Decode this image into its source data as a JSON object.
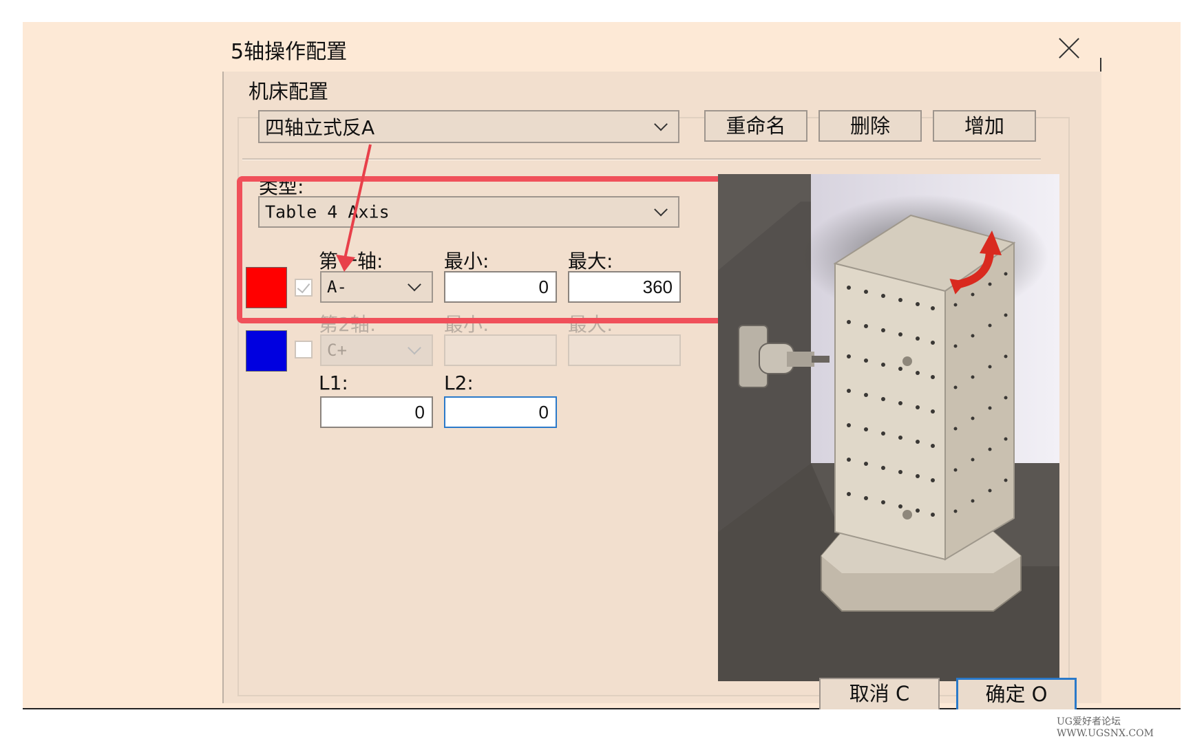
{
  "dialog": {
    "title": "5轴操作配置",
    "close_icon": "close-icon"
  },
  "machine_config": {
    "group_label": "机床配置",
    "selected": "四轴立式反A",
    "rename_label": "重命名",
    "delete_label": "删除",
    "add_label": "增加"
  },
  "type": {
    "label": "类型:",
    "selected": "Table 4 Axis"
  },
  "axis1": {
    "label": "第一轴:",
    "min_label": "最小:",
    "max_label": "最大:",
    "axis": "A-",
    "min": "0",
    "max": "360",
    "color": "#ff0000",
    "checked": true
  },
  "axis2": {
    "label": "第2轴:",
    "min_label": "最小:",
    "max_label": "最大:",
    "axis": "C+",
    "min": "",
    "max": "",
    "color": "#0000e0",
    "checked": false
  },
  "lengths": {
    "l1_label": "L1:",
    "l2_label": "L2:",
    "l1": "0",
    "l2": "0"
  },
  "footer": {
    "cancel_label": "取消 C",
    "ok_label": "确定 O"
  },
  "watermark": "UG爱好者论坛 WWW.UGSNX.COM",
  "colors": {
    "background": "#fde9d6",
    "dialog_body": "#f2dfce",
    "highlight": "#f0505a",
    "focus": "#2a79c9"
  }
}
